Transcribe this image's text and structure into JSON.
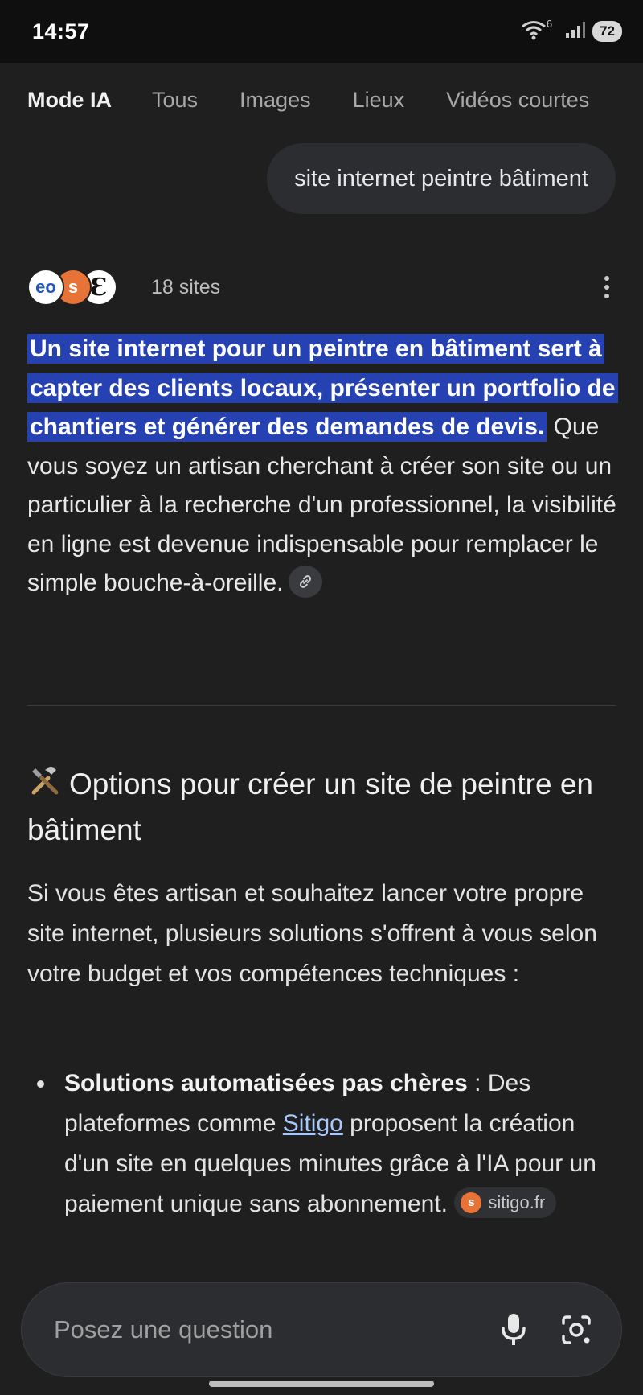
{
  "status": {
    "time": "14:57",
    "network_badge": "6",
    "battery": "72"
  },
  "tabs": [
    {
      "label": "Mode IA"
    },
    {
      "label": "Tous"
    },
    {
      "label": "Images"
    },
    {
      "label": "Lieux"
    },
    {
      "label": "Vidéos courtes"
    }
  ],
  "query": "site internet peintre bâtiment",
  "sources": {
    "favicons": [
      {
        "label": "eo",
        "color": "#2357b8"
      },
      {
        "label": "s",
        "color": "#e87336"
      },
      {
        "label": "Ɛ",
        "color": "#111111"
      }
    ],
    "count": "18 sites"
  },
  "answer": {
    "highlight": "Un site internet pour un peintre en bâtiment sert à capter des clients locaux, présenter un portfolio de chantiers et générer des demandes de devis.",
    "rest": " Que vous soyez un artisan cherchant à créer son site ou un particulier à la recherche d'un professionnel, la visibilité en ligne est devenue indispensable pour remplacer le simple bouche-à-oreille."
  },
  "section": {
    "title": "Options pour créer un site de peintre en bâtiment",
    "intro": "Si vous êtes artisan et souhaitez lancer votre propre site internet, plusieurs solutions s'offrent à vous selon votre budget et vos compétences techniques :",
    "bullets": [
      {
        "bold": "Solutions automatisées pas chères",
        "text_before_link": " : Des plateformes comme ",
        "link": "Sitigo",
        "text_after_link": " proposent la création d'un site en quelques minutes grâce à l'IA pour un paiement unique sans abonnement.",
        "source_chip": {
          "favicon": "s",
          "label": "sitigo.fr"
        }
      }
    ]
  },
  "ask_bar": {
    "placeholder": "Posez une question"
  },
  "colors": {
    "background": "#1f1f1f",
    "highlight": "#2541b2",
    "link": "#a8c7fa"
  }
}
